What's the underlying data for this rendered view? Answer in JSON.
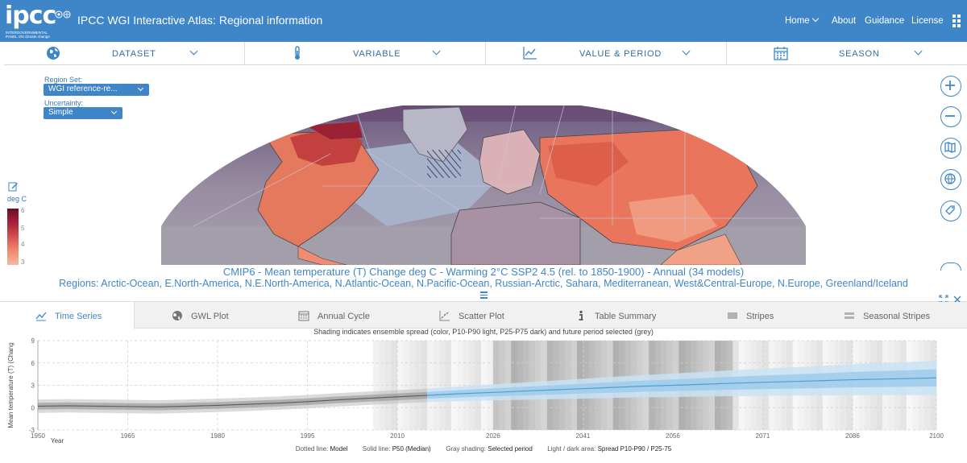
{
  "header": {
    "logo_text": "ipcc",
    "logo_sub": "INTERGOVERNMENTAL PANEL ON climate change",
    "title": "IPCC WGI Interactive Atlas: Regional information",
    "nav": {
      "home": "Home",
      "about": "About",
      "guidance": "Guidance",
      "license": "License"
    }
  },
  "toolbar": {
    "dataset": "DATASET",
    "variable": "VARIABLE",
    "value_period": "VALUE & PERIOD",
    "season": "SEASON"
  },
  "map_controls": {
    "region_set_label": "Region Set:",
    "region_set_value": "WGI reference-re...",
    "uncertainty_label": "Uncertainty:",
    "uncertainty_value": "Simple"
  },
  "legend": {
    "unit": "deg C",
    "ticks": [
      "6",
      "5",
      "4",
      "3"
    ]
  },
  "colors": {
    "accent": "#3f86c8",
    "model_line": "#5a5a5a",
    "median_line": "#4a9fd6",
    "spread_light": "#c9e3f5",
    "spread_dark": "#9fcbea"
  },
  "titles": {
    "main": "CMIP6 - Mean temperature (T) Change deg C - Warming 2°C SSP2 4.5 (rel. to 1850-1900) - Annual (34 models)",
    "regions": "Regions: Arctic-Ocean, E.North-America, N.E.North-America, N.Atlantic-Ocean, N.Pacific-Ocean, Russian-Arctic, Sahara, Mediterranean, West&Central-Europe, N.Europe, Greenland/Iceland"
  },
  "tabs": [
    {
      "label": "Time Series",
      "icon": "line-chart-icon",
      "active": true
    },
    {
      "label": "GWL Plot",
      "icon": "globe-icon",
      "active": false
    },
    {
      "label": "Annual Cycle",
      "icon": "calendar-icon",
      "active": false
    },
    {
      "label": "Scatter Plot",
      "icon": "scatter-icon",
      "active": false
    },
    {
      "label": "Table Summary",
      "icon": "info-icon",
      "active": false
    },
    {
      "label": "Stripes",
      "icon": "stripes-icon",
      "active": false
    },
    {
      "label": "Seasonal Stripes",
      "icon": "seasonal-stripes-icon",
      "active": false
    }
  ],
  "chart_note": "Shading indicates ensemble spread (color, P10-P90 light, P25-P75 dark) and future period selected (grey)",
  "footer_legend": {
    "dotted_label": "Dotted line:",
    "dotted_value": "Model",
    "solid_label": "Solid line:",
    "solid_value": "P50 (Median)",
    "gray_label": "Gray shading:",
    "gray_value": "Selected period",
    "area_label": "Light / dark area:",
    "area_value": "Spread P10-P90 / P25-75"
  },
  "chart_data": {
    "type": "line",
    "ylabel": "Mean temperature (T) (Chang",
    "xlabel": "Year",
    "xlim": [
      1950,
      2100
    ],
    "ylim": [
      -3,
      9
    ],
    "xticks": [
      1950,
      1965,
      1980,
      1995,
      2010,
      2026,
      2041,
      2056,
      2071,
      2086,
      2100
    ],
    "yticks": [
      -3,
      0,
      3,
      6,
      9
    ],
    "grid": true,
    "selected_period": [
      2026,
      2066
    ],
    "series": [
      {
        "segment": "historical",
        "x": [
          1950,
          1955,
          1960,
          1965,
          1970,
          1975,
          1980,
          1985,
          1990,
          1995,
          2000,
          2005,
          2010,
          2015
        ],
        "p50": [
          0.2,
          0.25,
          0.2,
          0.15,
          0.1,
          0.2,
          0.3,
          0.45,
          0.6,
          0.8,
          1.05,
          1.25,
          1.45,
          1.65
        ]
      },
      {
        "segment": "scenario",
        "x": [
          2015,
          2020,
          2026,
          2035,
          2041,
          2050,
          2056,
          2065,
          2071,
          2080,
          2086,
          2095,
          2100
        ],
        "p50": [
          1.65,
          1.85,
          2.05,
          2.35,
          2.55,
          2.85,
          3.0,
          3.25,
          3.4,
          3.6,
          3.75,
          3.9,
          4.0
        ]
      }
    ]
  }
}
